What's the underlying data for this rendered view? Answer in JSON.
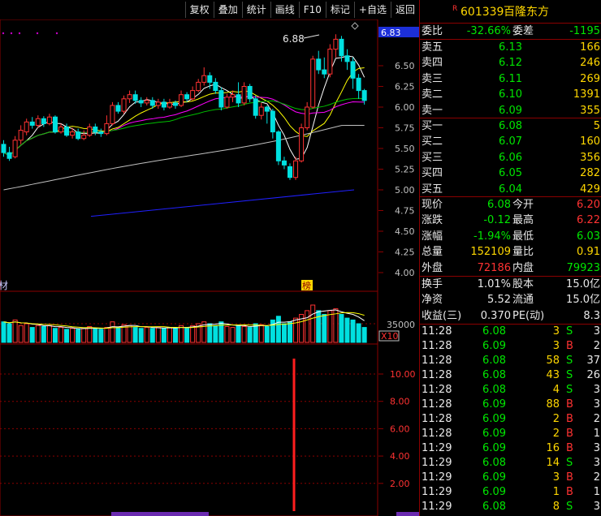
{
  "toolbar": {
    "buttons": [
      "复权",
      "叠加",
      "统计",
      "画线",
      "F10",
      "标记",
      "+自选",
      "返回"
    ]
  },
  "stock": {
    "r_mark": "R",
    "code": "601339",
    "name": "百隆东方"
  },
  "main_chart": {
    "high_label": "6.88",
    "price_box": "6.83",
    "y_ticks": [
      "6.50",
      "6.25",
      "6.00",
      "5.75",
      "5.50",
      "5.25",
      "5.00",
      "4.75",
      "4.50",
      "4.25",
      "4.00"
    ],
    "left_mark": "材",
    "bang_mark": "榜"
  },
  "volume_chart": {
    "tick": "35000",
    "unit": "X10"
  },
  "indicator_chart": {
    "y_ticks": [
      "10.00",
      "8.00",
      "6.00",
      "4.00",
      "2.00"
    ]
  },
  "weibi": {
    "label1": "委比",
    "value1": "-32.66%",
    "label2": "委差",
    "value2": "-1195"
  },
  "sell": [
    {
      "label": "卖五",
      "price": "6.13",
      "vol": "166"
    },
    {
      "label": "卖四",
      "price": "6.12",
      "vol": "246"
    },
    {
      "label": "卖三",
      "price": "6.11",
      "vol": "269"
    },
    {
      "label": "卖二",
      "price": "6.10",
      "vol": "1391"
    },
    {
      "label": "卖一",
      "price": "6.09",
      "vol": "355"
    }
  ],
  "buy": [
    {
      "label": "买一",
      "price": "6.08",
      "vol": "5"
    },
    {
      "label": "买二",
      "price": "6.07",
      "vol": "160"
    },
    {
      "label": "买三",
      "price": "6.06",
      "vol": "356"
    },
    {
      "label": "买四",
      "price": "6.05",
      "vol": "282"
    },
    {
      "label": "买五",
      "price": "6.04",
      "vol": "429"
    }
  ],
  "quote": [
    {
      "l1": "现价",
      "v1": "6.08",
      "l2": "今开",
      "v2": "6.20"
    },
    {
      "l1": "涨跌",
      "v1": "-0.12",
      "l2": "最高",
      "v2": "6.22"
    },
    {
      "l1": "涨幅",
      "v1": "-1.94%",
      "l2": "最低",
      "v2": "6.03"
    },
    {
      "l1": "总量",
      "v1": "152109",
      "l2": "量比",
      "v2": "0.91"
    },
    {
      "l1": "外盘",
      "v1": "72186",
      "l2": "内盘",
      "v2": "79923"
    }
  ],
  "finance": [
    {
      "l1": "换手",
      "v1": "1.01%",
      "l2": "股本",
      "v2": "15.0亿"
    },
    {
      "l1": "净资",
      "v1": "5.52",
      "l2": "流通",
      "v2": "15.0亿"
    },
    {
      "l1": "收益(三)",
      "v1": "0.370",
      "l2": "PE(动)",
      "v2": "8.3"
    }
  ],
  "ticks": [
    {
      "time": "11:28",
      "price": "6.08",
      "vol": "3",
      "bs": "S",
      "n": "3"
    },
    {
      "time": "11:28",
      "price": "6.09",
      "vol": "3",
      "bs": "B",
      "n": "2"
    },
    {
      "time": "11:28",
      "price": "6.08",
      "vol": "58",
      "bs": "S",
      "n": "37"
    },
    {
      "time": "11:28",
      "price": "6.08",
      "vol": "43",
      "bs": "S",
      "n": "26"
    },
    {
      "time": "11:28",
      "price": "6.08",
      "vol": "4",
      "bs": "S",
      "n": "3"
    },
    {
      "time": "11:28",
      "price": "6.09",
      "vol": "88",
      "bs": "B",
      "n": "3"
    },
    {
      "time": "11:28",
      "price": "6.09",
      "vol": "2",
      "bs": "B",
      "n": "2"
    },
    {
      "time": "11:28",
      "price": "6.09",
      "vol": "2",
      "bs": "B",
      "n": "1"
    },
    {
      "time": "11:29",
      "price": "6.09",
      "vol": "16",
      "bs": "B",
      "n": "3"
    },
    {
      "time": "11:29",
      "price": "6.08",
      "vol": "14",
      "bs": "S",
      "n": "3"
    },
    {
      "time": "11:29",
      "price": "6.09",
      "vol": "3",
      "bs": "B",
      "n": "2"
    },
    {
      "time": "11:29",
      "price": "6.09",
      "vol": "1",
      "bs": "B",
      "n": "1"
    },
    {
      "time": "11:29",
      "price": "6.08",
      "vol": "8",
      "bs": "S",
      "n": "3"
    }
  ],
  "colors": {
    "up": "#ff3232",
    "down": "#00e0e0",
    "ma5": "#ffffff",
    "ma10": "#ffff00",
    "ma20": "#ff00ff",
    "ma30": "#00c000",
    "ma60": "#c0c0c0",
    "ma250": "#2020ff",
    "grid": "#8b0000"
  }
}
